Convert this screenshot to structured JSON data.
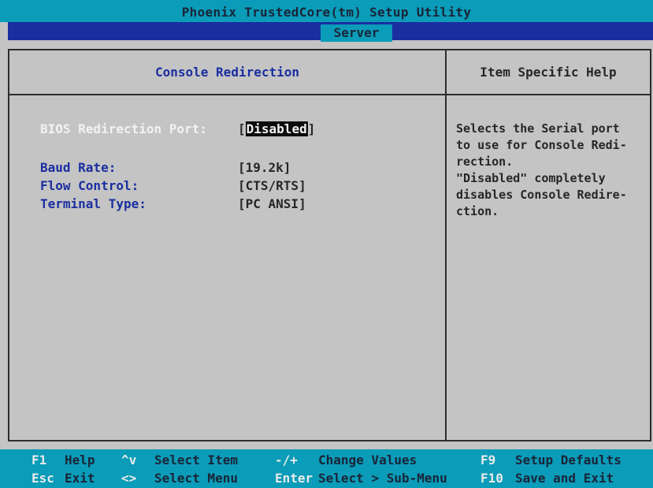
{
  "title": "Phoenix TrustedCore(tm) Setup Utility",
  "menu": {
    "active_tab": "Server"
  },
  "panel": {
    "title": "Console Redirection",
    "fields": [
      {
        "label": "BIOS Redirection Port:",
        "value": "Disabled",
        "selected": true
      },
      {
        "label": "Baud Rate:",
        "value": "[19.2k]"
      },
      {
        "label": "Flow Control:",
        "value": "[CTS/RTS]"
      },
      {
        "label": "Terminal Type:",
        "value": "[PC ANSI]"
      }
    ]
  },
  "help": {
    "title": "Item Specific Help",
    "lines": [
      "Selects the Serial port",
      "to use for Console Redi-",
      "rection.",
      "\"Disabled\" completely",
      "disables Console Redire-",
      "ction."
    ]
  },
  "status_bar": {
    "row1": [
      {
        "key": "F1",
        "text": "Help"
      },
      {
        "key": "^v",
        "text": "Select Item"
      },
      {
        "key": "-/+",
        "text": "Change Values"
      },
      {
        "key": "F9",
        "text": "Setup Defaults"
      }
    ],
    "row2": [
      {
        "key": "Esc",
        "text": "Exit"
      },
      {
        "key": "<>",
        "text": "Select Menu"
      },
      {
        "key": "Enter",
        "text": "Select > Sub-Menu"
      },
      {
        "key": "F10",
        "text": "Save and Exit"
      }
    ]
  },
  "colors": {
    "background": "#c4c4c4",
    "title_bar": "#0a9cb8",
    "menu_bar": "#1a2ea0",
    "label_blue": "#1a2ea0"
  }
}
